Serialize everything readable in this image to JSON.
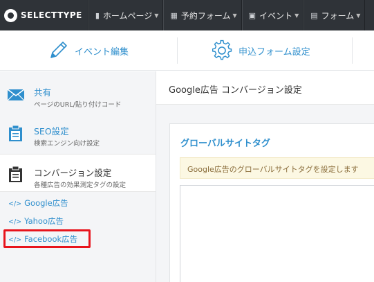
{
  "brand": {
    "name": "SELECTTYPE"
  },
  "nav": [
    {
      "label": "ホームページ",
      "icon": "document-icon"
    },
    {
      "label": "予約フォーム",
      "icon": "calendar-icon"
    },
    {
      "label": "イベント",
      "icon": "chat-bubble-icon"
    },
    {
      "label": "フォーム",
      "icon": "form-icon"
    }
  ],
  "actions": {
    "edit_event": "イベント編集",
    "form_settings": "申込フォーム設定"
  },
  "sidebar": {
    "items": [
      {
        "title": "共有",
        "subtitle": "ページのURL/貼り付けコード",
        "icon": "envelope-icon"
      },
      {
        "title": "SEO設定",
        "subtitle": "検索エンジン向け設定",
        "icon": "clipboard-icon"
      },
      {
        "title": "コンバージョン設定",
        "subtitle": "各種広告の効果測定タグの設定",
        "icon": "clipboard-icon"
      }
    ],
    "links": [
      {
        "code": "</>",
        "label": "Google広告"
      },
      {
        "code": "</>",
        "label": "Yahoo広告"
      },
      {
        "code": "</>",
        "label": "Facebook広告"
      }
    ]
  },
  "main": {
    "title": "Google広告 コンバージョン設定",
    "card": {
      "title": "グローバルサイトタグ",
      "alert": "Google広告のグローバルサイトタグを設定します",
      "textarea_value": ""
    }
  },
  "colors": {
    "topbar": "#2f3338",
    "accent": "#2f8fcd",
    "highlight": "#e8141c",
    "alert_bg": "#fcf8e3"
  }
}
